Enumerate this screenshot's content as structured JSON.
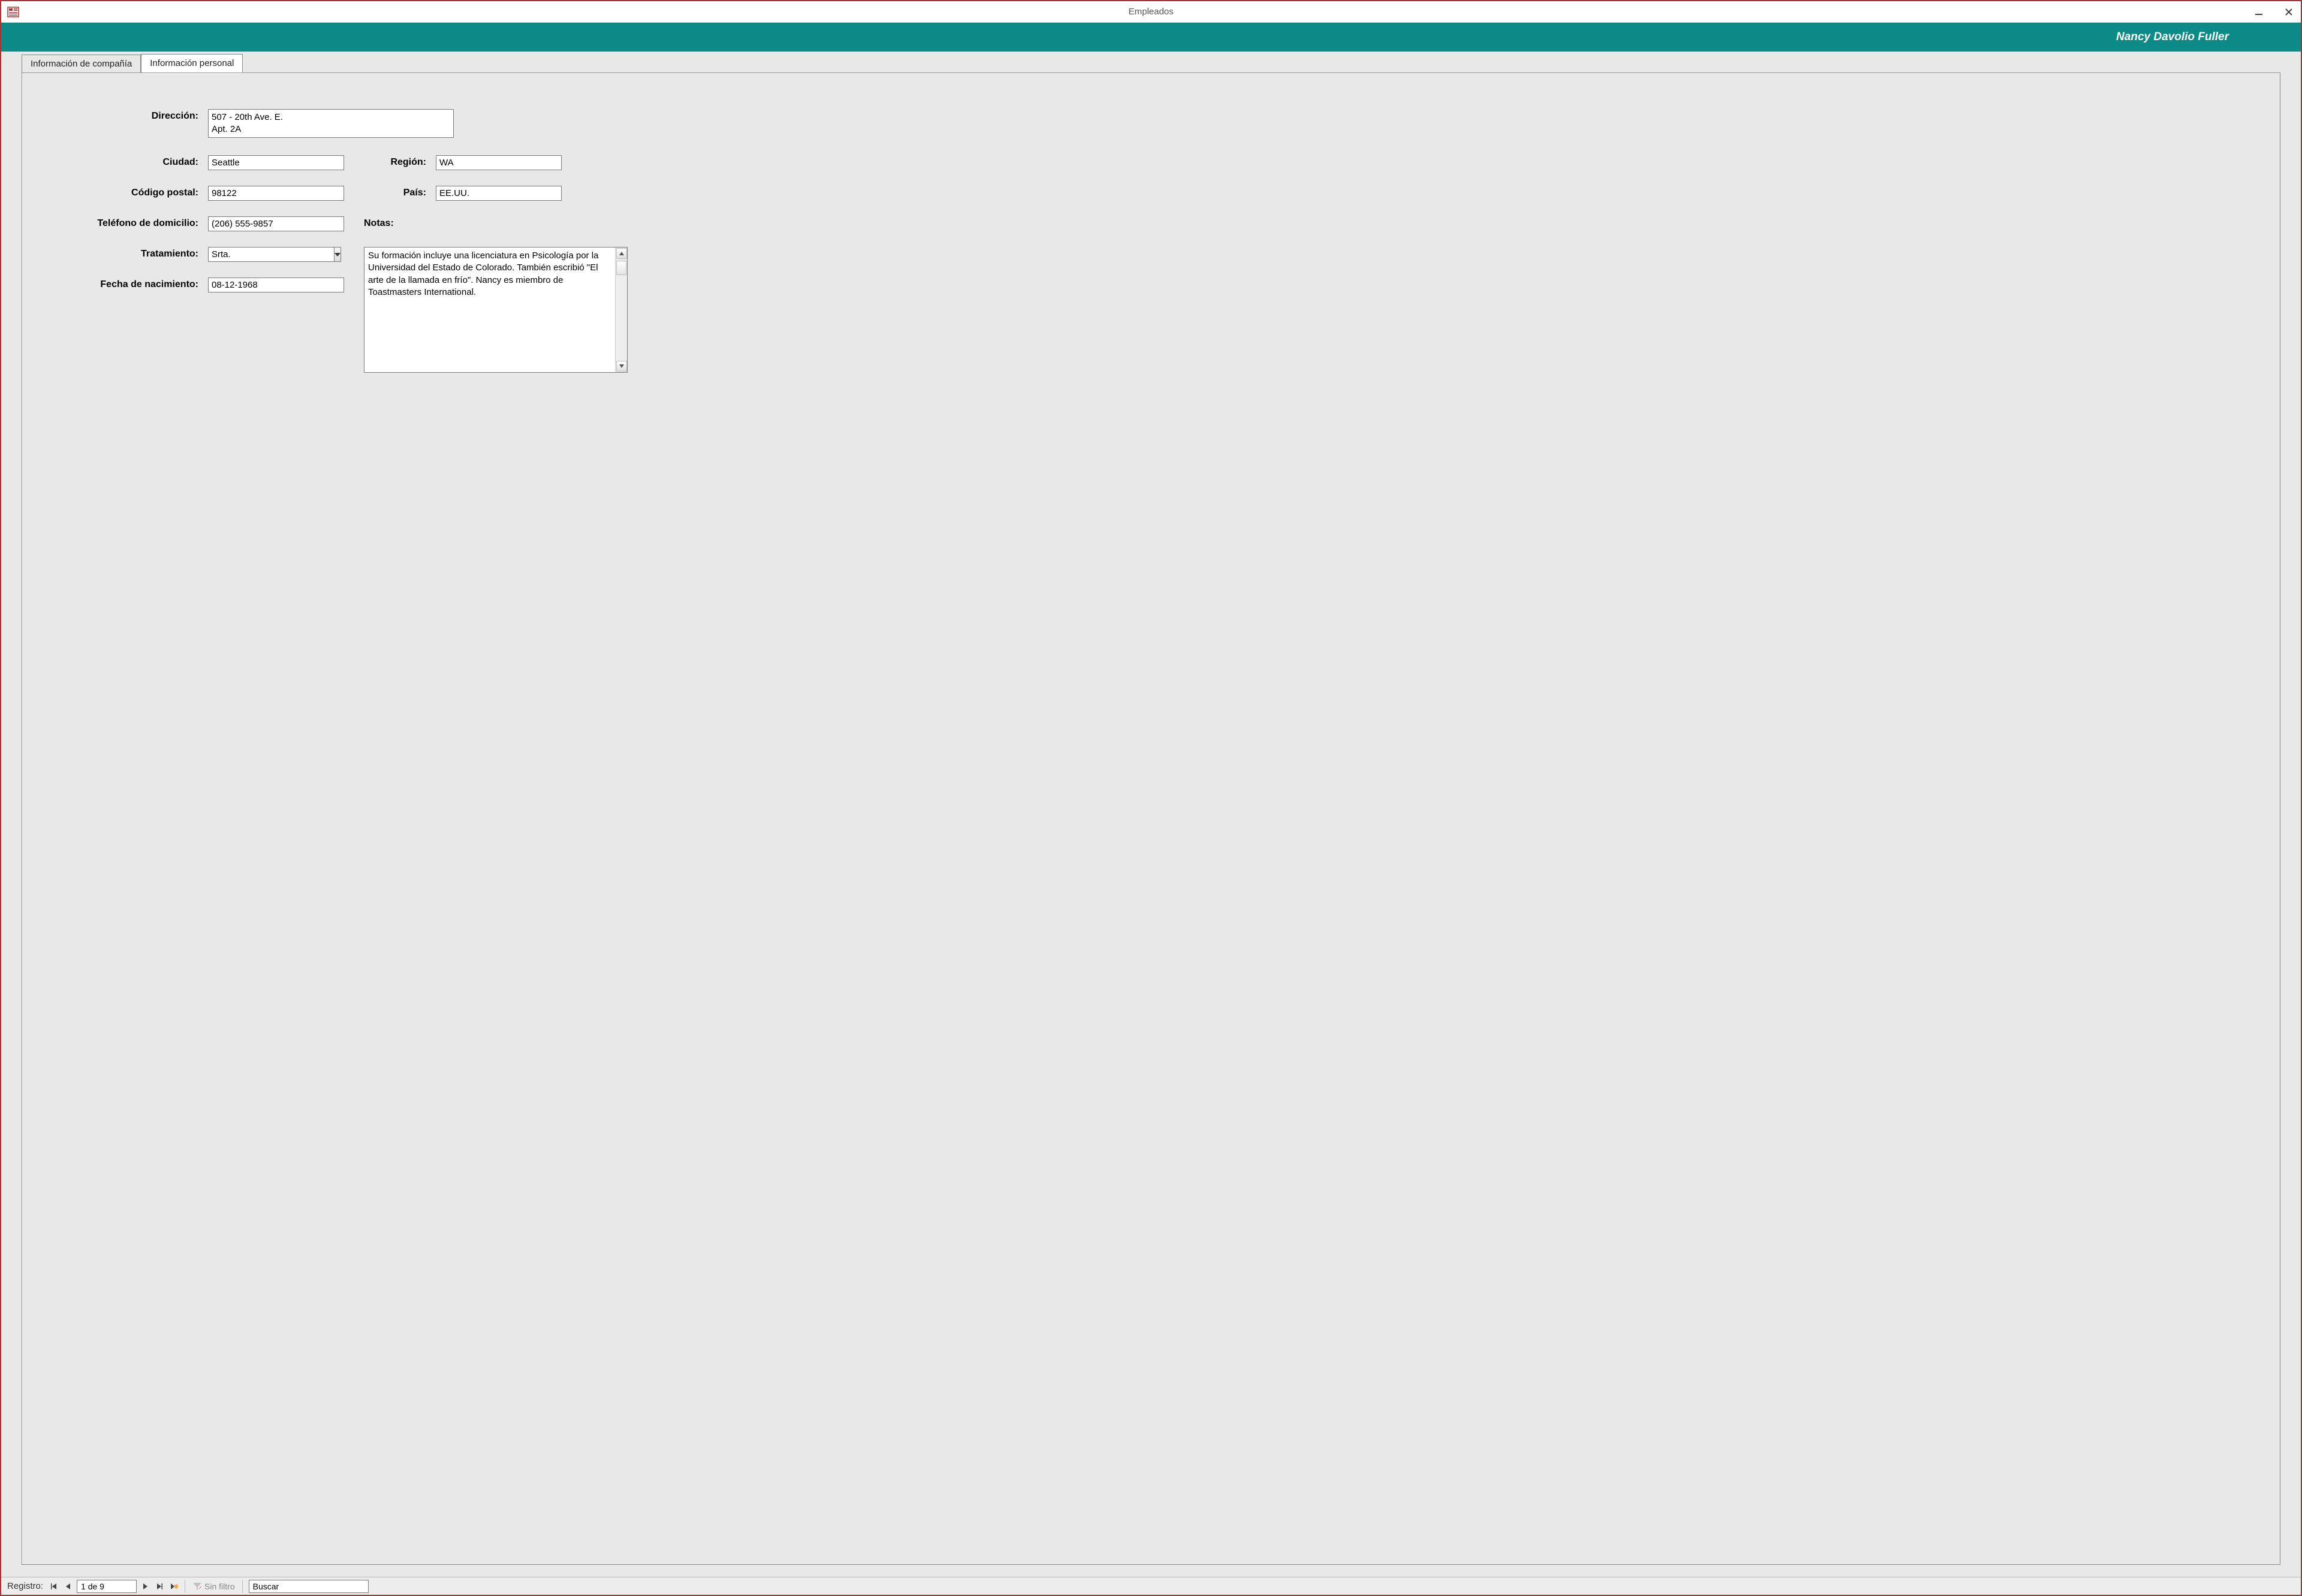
{
  "window": {
    "title": "Empleados"
  },
  "header": {
    "employee_name": "Nancy Davolio Fuller"
  },
  "tabs": {
    "company": "Información de compañía",
    "personal": "Información personal"
  },
  "labels": {
    "address": "Dirección:",
    "city": "Ciudad:",
    "postal": "Código postal:",
    "phone": "Teléfono de domicilio:",
    "title_of_courtesy": "Tratamiento:",
    "birthdate": "Fecha de nacimiento:",
    "region": "Región:",
    "country": "País:",
    "notes": "Notas:"
  },
  "fields": {
    "address": "507 - 20th Ave. E.\nApt. 2A",
    "city": "Seattle",
    "postal": "98122",
    "phone": "(206) 555-9857",
    "title_of_courtesy": "Srta.",
    "birthdate": "08-12-1968",
    "region": "WA",
    "country": "EE.UU.",
    "notes": "Su formación incluye una licenciatura en Psicología por la Universidad del Estado de Colorado. También escribió \"El arte de la llamada en frío\". Nancy es miembro de Toastmasters International."
  },
  "nav": {
    "label": "Registro:",
    "position": "1 de 9",
    "filter_label": "Sin filtro",
    "search_placeholder": "Buscar"
  }
}
